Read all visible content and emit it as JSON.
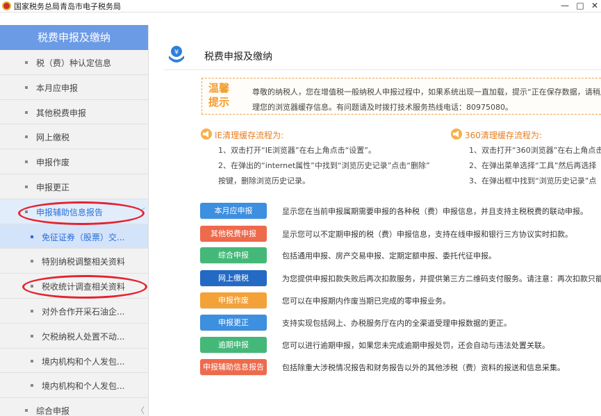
{
  "window": {
    "title": "国家税务总局青岛市电子税务局",
    "min": "—",
    "max": "□",
    "close": "✕"
  },
  "sidebar": {
    "header": "税费申报及缴纳",
    "items": [
      {
        "label": "税（费）种认定信息"
      },
      {
        "label": "本月应申报"
      },
      {
        "label": "其他税费申报"
      },
      {
        "label": "网上缴税"
      },
      {
        "label": "申报作废"
      },
      {
        "label": "申报更正"
      },
      {
        "label": "申报辅助信息报告",
        "caret": "﹀"
      },
      {
        "label": "免征证券（股票）交..."
      },
      {
        "label": "特别纳税调整相关资料"
      },
      {
        "label": "税收统计调查相关资料"
      },
      {
        "label": "对外合作开采石油企..."
      },
      {
        "label": "欠税纳税人处置不动..."
      },
      {
        "label": "境内机构和个人发包..."
      },
      {
        "label": "境内机构和个人发包..."
      },
      {
        "label": "综合申报",
        "caret": "〈"
      }
    ]
  },
  "main": {
    "title": "税费申报及缴纳",
    "notice": {
      "badge_line1": "温馨",
      "badge_line2": "提示",
      "line1": "尊敬的纳税人，您在增值税一般纳税人申报过程中，如果系统出现一直加载，提示“正在保存数据，请稍后",
      "line2": "理您的浏览器缓存信息。有问题请及时拨打技术服务热线电话：80975080。"
    },
    "ie": {
      "title": "IE清理缓存流程为:",
      "step1": "1、双击打开“IE浏览器”在右上角点击“设置”。",
      "step2": "2、在弹出的“internet属性”中找到“浏览历史记录”点击“删除”",
      "step2b": "按键，删除浏览历史记录。"
    },
    "b360": {
      "title": "360清理缓存流程为:",
      "step1": "1、双击打开“360浏览器”在右上角点击",
      "step2": "2、在弹出菜单选择“工具”然后再选择",
      "step3": "3、在弹出框中找到“浏览历史记录”点"
    },
    "services": [
      {
        "label": "本月应申报",
        "desc": "显示您在当前申报属期需要申报的各种税（费）申报信息，并且支持主税税费的联动申报。",
        "color": "#3d8fe0"
      },
      {
        "label": "其他税费申报",
        "desc": "显示您可以不定期申报的税（费）申报信息，支持在线申报和银行三方协议实时扣款。",
        "color": "#ee6a4c"
      },
      {
        "label": "综合申报",
        "desc": "包括通用申报、房产交易申报、定期定额申报、委托代征申报。",
        "color": "#44b878"
      },
      {
        "label": "网上缴税",
        "desc": "为您提供申报扣款失败后再次扣款服务，并提供第三方二维码支付服务。请注意：再次扣款只能缴",
        "color": "#2469c4"
      },
      {
        "label": "申报作废",
        "desc": "您可以在申报期内作废当期已完成的零申报业务。",
        "color": "#f3a23a"
      },
      {
        "label": "申报更正",
        "desc": "支持实现包括网上、办税服务厅在内的全渠道受理申报数据的更正。",
        "color": "#3d8fe0"
      },
      {
        "label": "逾期申报",
        "desc": "您可以进行逾期申报，如果您未完成逾期申报处罚，还会自动与违法处置关联。",
        "color": "#44b878"
      },
      {
        "label": "申报辅助信息报告",
        "desc": "包括除重大涉税情况报告和财务报告以外的其他涉税（费）资料的报送和信息采集。",
        "color": "#ee6a4c"
      }
    ]
  },
  "colors": {
    "sidebar_header": "#6b9be5",
    "accent_blue": "#2a6fd6",
    "annotation_red": "#e5232f",
    "notice_orange": "#f39c2a"
  }
}
